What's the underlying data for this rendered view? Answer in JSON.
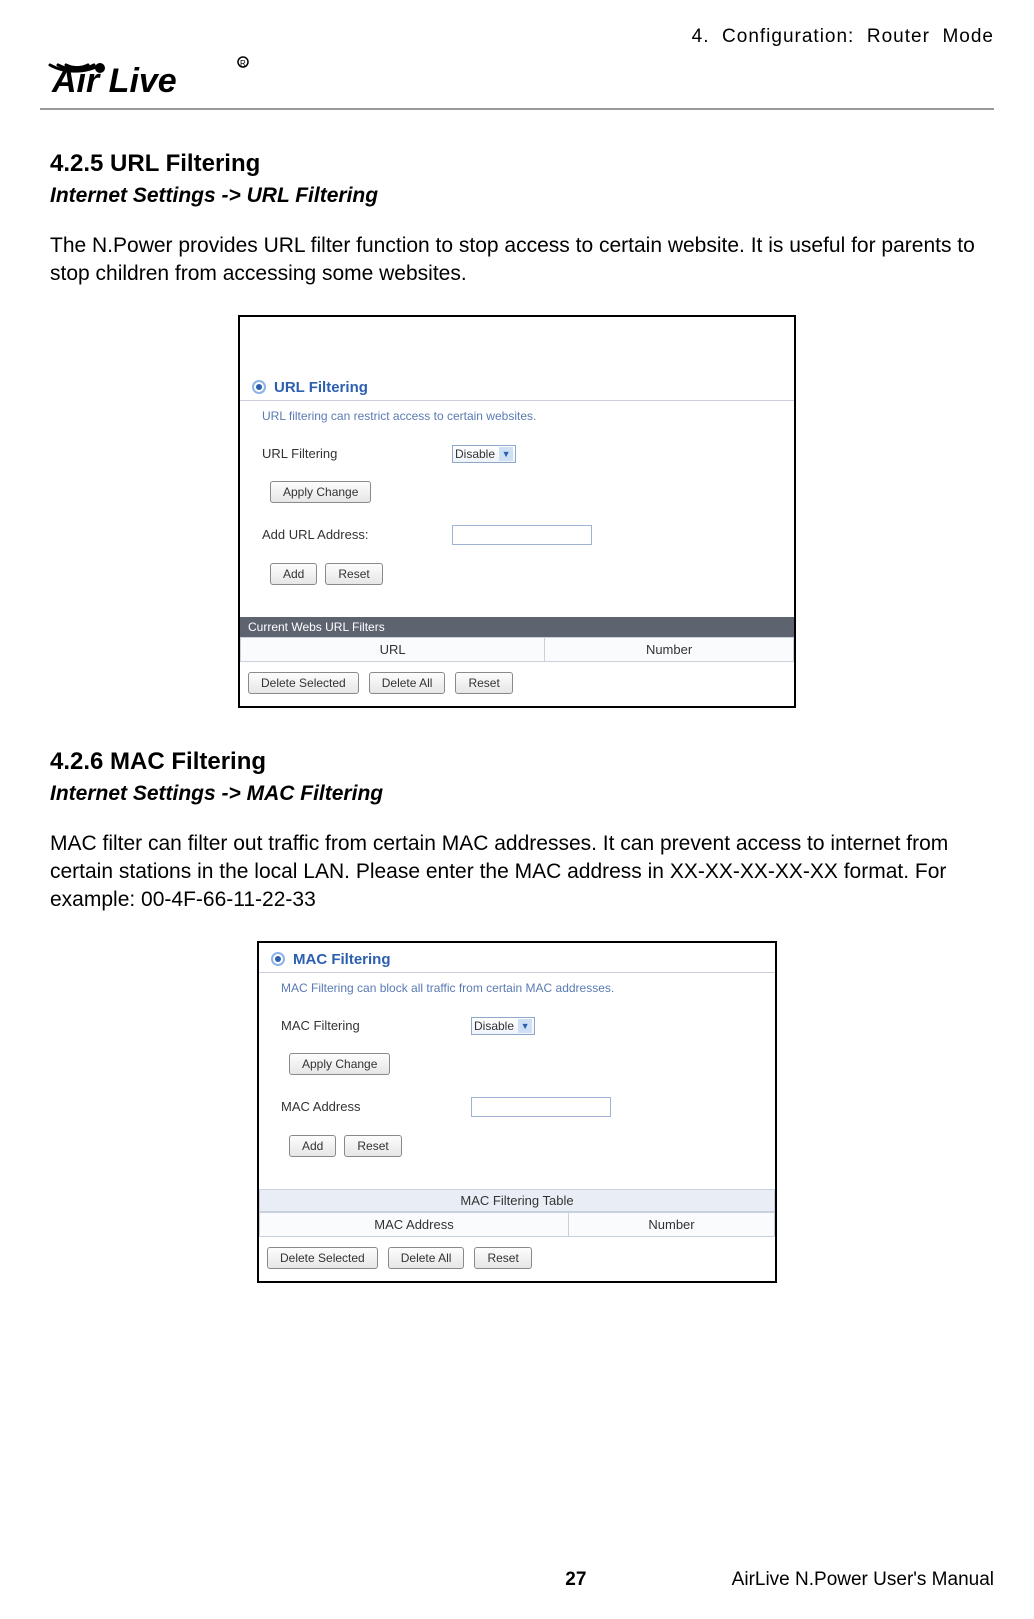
{
  "header": {
    "brand_text": "Air Live",
    "chapter": "4.  Configuration:  Router  Mode"
  },
  "section1": {
    "heading": "4.2.5 URL Filtering",
    "path": "Internet Settings -> URL Filtering",
    "paragraph": "The N.Power provides URL filter function to stop access to certain website. It is useful for parents to stop children from accessing some websites."
  },
  "panel_url": {
    "title": "URL Filtering",
    "desc": "URL filtering can restrict access to certain websites.",
    "filter_label": "URL Filtering",
    "select_value": "Disable",
    "apply_btn": "Apply Change",
    "add_label": "Add URL Address:",
    "add_btn": "Add",
    "reset_btn": "Reset",
    "table_title": "Current Webs URL Filters",
    "col1": "URL",
    "col2": "Number",
    "del_sel": "Delete Selected",
    "del_all": "Delete All",
    "reset2": "Reset"
  },
  "section2": {
    "heading": "4.2.6 MAC Filtering",
    "path": "Internet Settings -> MAC Filtering",
    "paragraph": "MAC filter can filter out traffic from certain MAC addresses. It can prevent access to internet from certain stations in the local LAN.    Please enter the MAC address in XX-XX-XX-XX-XX format.    For example: 00-4F-66-11-22-33"
  },
  "panel_mac": {
    "title": "MAC Filtering",
    "desc": "MAC Filtering can block all traffic from certain MAC addresses.",
    "filter_label": "MAC Filtering",
    "select_value": "Disable",
    "apply_btn": "Apply Change",
    "add_label": "MAC Address",
    "add_btn": "Add",
    "reset_btn": "Reset",
    "table_title": "MAC Filtering Table",
    "col1": "MAC Address",
    "col2": "Number",
    "del_sel": "Delete Selected",
    "del_all": "Delete All",
    "reset2": "Reset"
  },
  "footer": {
    "page": "27",
    "manual": "AirLive N.Power User's Manual"
  }
}
